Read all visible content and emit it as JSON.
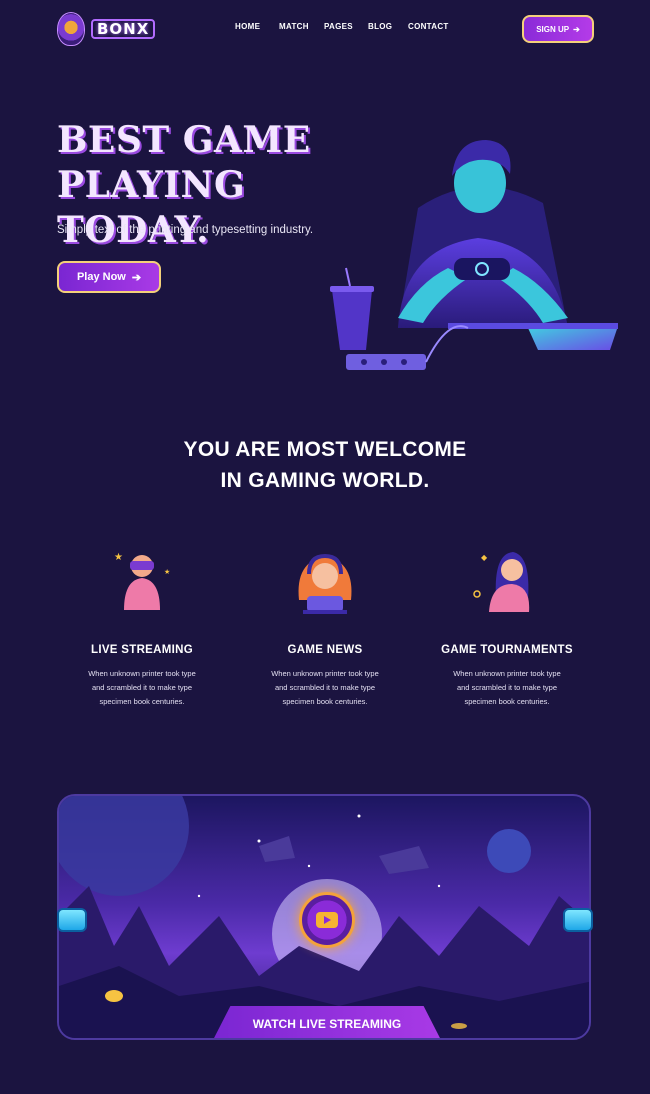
{
  "brand": {
    "name": "BONX"
  },
  "nav": {
    "items": [
      "HOME",
      "MATCH",
      "PAGES",
      "BLOG",
      "CONTACT"
    ],
    "signup_label": "SIGN UP"
  },
  "hero": {
    "title_line1": "BEST GAME",
    "title_line2": "PLAYING TODAY.",
    "subtitle": "Simply text of the printing and typesetting industry.",
    "cta_label": "Play Now"
  },
  "welcome": {
    "line1": "YOU ARE MOST WELCOME",
    "line2": "IN GAMING WORLD."
  },
  "features": [
    {
      "title": "LIVE STREAMING",
      "text": "When unknown printer took type and scrambled it to make type specimen book centuries."
    },
    {
      "title": "GAME NEWS",
      "text": "When unknown printer took type and scrambled it to make type specimen book centuries."
    },
    {
      "title": "GAME TOURNAMENTS",
      "text": "When unknown printer took type and scrambled it to make type specimen book centuries."
    }
  ],
  "banner": {
    "cta_label": "WATCH LIVE STREAMING"
  },
  "icons": {
    "logo": "lion-crest-icon",
    "arrow": "arrow-right-icon",
    "play": "play-icon"
  },
  "colors": {
    "background": "#1b1440",
    "accent_purple": "#a93ae6",
    "accent_gold": "#f4d07a"
  }
}
